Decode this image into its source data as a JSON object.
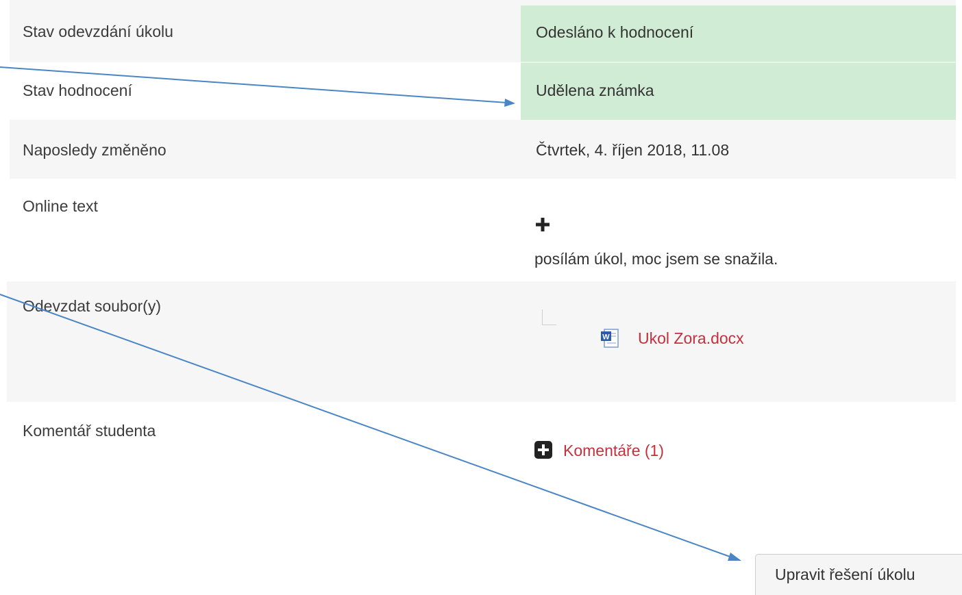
{
  "rows": {
    "submission_status": {
      "label": "Stav odevzdání úkolu",
      "value": "Odesláno k hodnocení"
    },
    "grading_status": {
      "label": "Stav hodnocení",
      "value": "Udělena známka"
    },
    "last_modified": {
      "label": "Naposledy změněno",
      "value": "Čtvrtek, 4. říjen 2018, 11.08"
    },
    "online_text": {
      "label": "Online text",
      "value": "posílám úkol, moc jsem se snažila.",
      "expand_icon": "plus-icon"
    },
    "file_submissions": {
      "label": "Odevzdat soubor(y)",
      "file_name": "Ukol Zora.docx",
      "file_icon": "word-document-icon"
    },
    "student_comments": {
      "label": "Komentář studenta",
      "comments_link": "Komentáře (1)",
      "toggle_icon": "plus-square-icon"
    }
  },
  "actions": {
    "edit_submission": "Upravit řešení úkolu"
  },
  "colors": {
    "status_success_bg": "#d1ecd4",
    "link": "#c4303b",
    "annotation_arrow": "#4a86c5",
    "row_stripe": "#f6f6f6"
  }
}
